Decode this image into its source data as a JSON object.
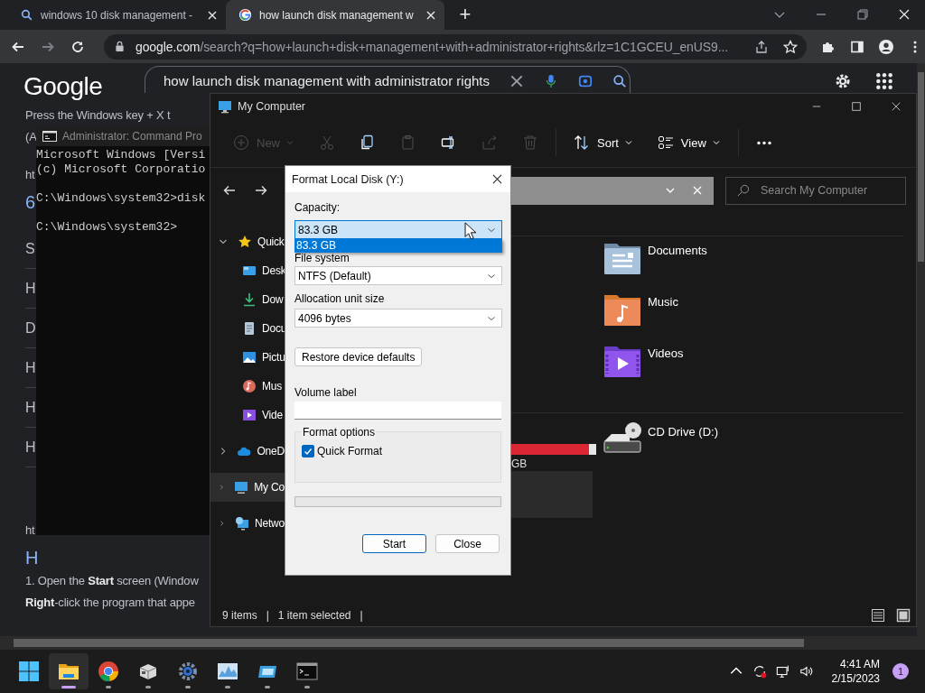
{
  "browser": {
    "tabs": [
      {
        "kind": "search",
        "title": "windows 10 disk management - ",
        "selected": false
      },
      {
        "kind": "google",
        "title": "how launch disk management w",
        "selected": true
      }
    ],
    "new_tab": "+",
    "nav": [
      {
        "kind": "back",
        "disabled": false
      },
      {
        "kind": "forward",
        "disabled": true
      },
      {
        "kind": "reload",
        "disabled": false
      }
    ],
    "url": {
      "host": "google.com",
      "path": "/search?q=how+launch+disk+management+with+administrator+rights&rlz=1C1GCEU_enUS9..."
    }
  },
  "google": {
    "logo": "Google",
    "query": "how launch disk management with administrator rights"
  },
  "page_lines": [
    {
      "kind": "para",
      "text": "Press the Windows key + X t"
    },
    {
      "kind": "para",
      "text": "(A"
    },
    {
      "kind": "url",
      "text": "ht"
    },
    {
      "kind": "heading",
      "text": "6"
    },
    {
      "kind": "qa",
      "text": "S"
    },
    {
      "kind": "qa",
      "text": "H"
    },
    {
      "kind": "qa",
      "text": "D"
    },
    {
      "kind": "qa",
      "text": "H"
    },
    {
      "kind": "qa",
      "text": "H"
    },
    {
      "kind": "qa",
      "text": "H"
    },
    {
      "kind": "url",
      "text": "ht"
    },
    {
      "kind": "heading",
      "text": "H"
    },
    {
      "kind": "para",
      "text": "1. Open the **Start** screen (Window"
    },
    {
      "kind": "para",
      "text": "**Right**-click the program that appe"
    }
  ],
  "cmd": {
    "title": "Administrator: Command Pro",
    "lines": [
      {
        "text": "Microsoft Windows [Versi",
        "blank_before": false
      },
      {
        "text": "(c) Microsoft Corporatio",
        "blank_before": false
      },
      {
        "text": "C:\\Windows\\system32>disk",
        "blank_before": true
      },
      {
        "text": "C:\\Windows\\system32>",
        "blank_before": true
      }
    ]
  },
  "explorer": {
    "title": "My Computer",
    "toolbar": [
      {
        "kind": "new",
        "label": "New",
        "disabled": true
      },
      {
        "kind": "cut",
        "disabled": true
      },
      {
        "kind": "copy",
        "disabled": false
      },
      {
        "kind": "paste",
        "disabled": true
      },
      {
        "kind": "rename",
        "disabled": false
      },
      {
        "kind": "share",
        "disabled": true
      },
      {
        "kind": "delete",
        "disabled": true
      },
      {
        "kind": "sort",
        "label": "Sort",
        "disabled": false
      },
      {
        "kind": "view",
        "label": "View",
        "disabled": false
      },
      {
        "kind": "more",
        "disabled": false
      }
    ],
    "search": {
      "placeholder": "Search My Computer"
    },
    "sidebar": [
      {
        "kind": "star",
        "label": "Quick",
        "expanded": true,
        "selected": false,
        "children": [
          {
            "kind": "desktop",
            "label": "Desk"
          },
          {
            "kind": "download",
            "label": "Dow"
          },
          {
            "kind": "document",
            "label": "Docu"
          },
          {
            "kind": "picture",
            "label": "Pictu"
          },
          {
            "kind": "music",
            "label": "Mus"
          },
          {
            "kind": "video",
            "label": "Vide"
          }
        ]
      },
      {
        "kind": "cloud",
        "label": "OneD",
        "expanded": false,
        "selected": false
      },
      {
        "kind": "computer",
        "label": "My Co",
        "expanded": false,
        "selected": true
      },
      {
        "kind": "network",
        "label": "Netwo",
        "expanded": false,
        "selected": false
      }
    ],
    "folders": [
      {
        "kind": "documents",
        "label": "Documents"
      },
      {
        "kind": "music",
        "label": "Music"
      },
      {
        "kind": "videos",
        "label": "Videos"
      }
    ],
    "drives": [
      {
        "kind": "local",
        "caption": "GB",
        "level": 0.95
      },
      {
        "kind": "cd",
        "label": "CD Drive (D:)"
      }
    ],
    "status": [
      "9 items",
      "|",
      "1 item selected",
      "|"
    ]
  },
  "dialog": {
    "title": "Format Local Disk (Y:)",
    "capacity": {
      "label": "Capacity:",
      "value": "83.3 GB",
      "focused": true,
      "open": true,
      "options": [
        {
          "text": "83.3 GB",
          "selected": true
        }
      ]
    },
    "file_system": {
      "label": "File system",
      "value": "NTFS (Default)"
    },
    "allocation": {
      "label": "Allocation unit size",
      "value": "4096 bytes"
    },
    "restore_button": "Restore device defaults",
    "volume_label": {
      "label": "Volume label"
    },
    "format_options": {
      "title": "Format options",
      "quick_format": {
        "label": "Quick Format",
        "checked": true
      }
    },
    "progress": {
      "level": 0
    },
    "buttons": [
      {
        "label": "Start",
        "default": true
      },
      {
        "label": "Close",
        "default": false
      }
    ]
  },
  "taskbar": {
    "apps": [
      {
        "kind": "start",
        "running": false,
        "active": false
      },
      {
        "kind": "explorer",
        "running": true,
        "active": true
      },
      {
        "kind": "chrome",
        "running": true,
        "active": false
      },
      {
        "kind": "box",
        "running": true,
        "active": false
      },
      {
        "kind": "settings",
        "running": true,
        "active": false
      },
      {
        "kind": "monitor",
        "running": true,
        "active": false
      },
      {
        "kind": "window",
        "running": true,
        "active": false
      },
      {
        "kind": "terminal",
        "running": true,
        "active": false
      }
    ],
    "time": "4:41 AM",
    "date": "2/15/2023",
    "badge": "1"
  }
}
